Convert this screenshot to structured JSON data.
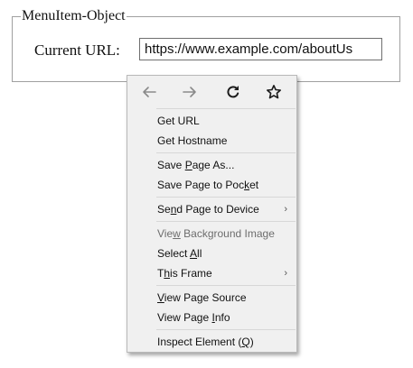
{
  "group": {
    "legend": "MenuItem-Object",
    "url_label": "Current URL:",
    "url_value": "https://www.example.com/aboutUs"
  },
  "menu": {
    "nav": {
      "back_icon": "arrow-left",
      "forward_icon": "arrow-right",
      "reload_icon": "reload",
      "bookmark_icon": "star",
      "disabled_color": "#8a8a8a",
      "active_color": "#1c1c1c"
    },
    "items": [
      {
        "pre": "Get URL",
        "u": "",
        "post": "",
        "disabled": false,
        "submenu": false
      },
      {
        "pre": "Get Hostname",
        "u": "",
        "post": "",
        "disabled": false,
        "submenu": false
      },
      {
        "pre": "Save ",
        "u": "P",
        "post": "age As...",
        "disabled": false,
        "submenu": false
      },
      {
        "pre": "Save Page to Poc",
        "u": "k",
        "post": "et",
        "disabled": false,
        "submenu": false
      },
      {
        "pre": "Se",
        "u": "n",
        "post": "d Page to Device",
        "disabled": false,
        "submenu": true
      },
      {
        "pre": "Vie",
        "u": "w",
        "post": " Background Image",
        "disabled": true,
        "submenu": false
      },
      {
        "pre": "Select ",
        "u": "A",
        "post": "ll",
        "disabled": false,
        "submenu": false
      },
      {
        "pre": "T",
        "u": "h",
        "post": "is Frame",
        "disabled": false,
        "submenu": true
      },
      {
        "pre": "",
        "u": "V",
        "post": "iew Page Source",
        "disabled": false,
        "submenu": false
      },
      {
        "pre": "View Page ",
        "u": "I",
        "post": "nfo",
        "disabled": false,
        "submenu": false
      },
      {
        "pre": "Inspect Element (",
        "u": "Q",
        "post": ")",
        "disabled": false,
        "submenu": false
      }
    ],
    "submenu_arrow": "›"
  }
}
